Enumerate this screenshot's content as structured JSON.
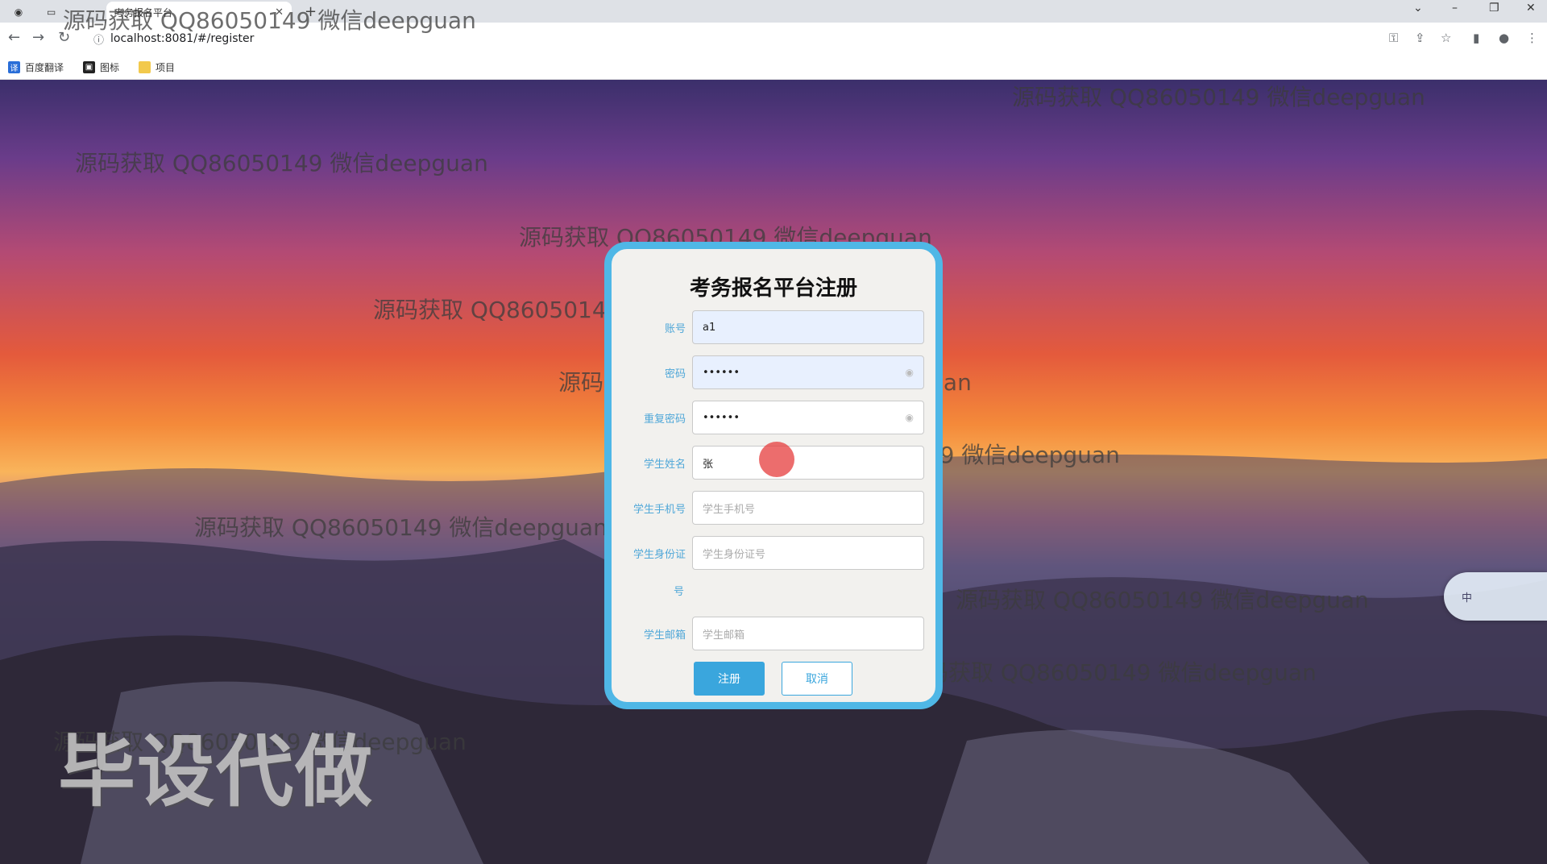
{
  "browser": {
    "active_tab_title": "考务报名平台",
    "url": "localhost:8081/#/register",
    "bookmarks": [
      {
        "label": "百度翻译",
        "icon": "translate-icon"
      },
      {
        "label": "图标",
        "icon": "image-icon"
      },
      {
        "label": "项目",
        "icon": "folder-icon"
      }
    ]
  },
  "form": {
    "title": "考务报名平台注册",
    "account_label": "账号",
    "account_value": "a1",
    "password_label": "密码",
    "password_value": "••••••",
    "confirm_label": "重复密码",
    "confirm_value": "••••••",
    "name_label": "学生姓名",
    "name_value": "张",
    "phone_label": "学生手机号",
    "phone_placeholder": "学生手机号",
    "idcard_label": "学生身份证",
    "idcard_label_wrap": "号",
    "idcard_placeholder": "学生身份证号",
    "email_label": "学生邮箱",
    "email_placeholder": "学生邮箱",
    "register_button": "注册",
    "cancel_button": "取消"
  },
  "watermark": {
    "text": "源码获取 QQ86050149 微信deepguan",
    "big_text": "毕设代做"
  },
  "side_widget": {
    "label": "中"
  }
}
